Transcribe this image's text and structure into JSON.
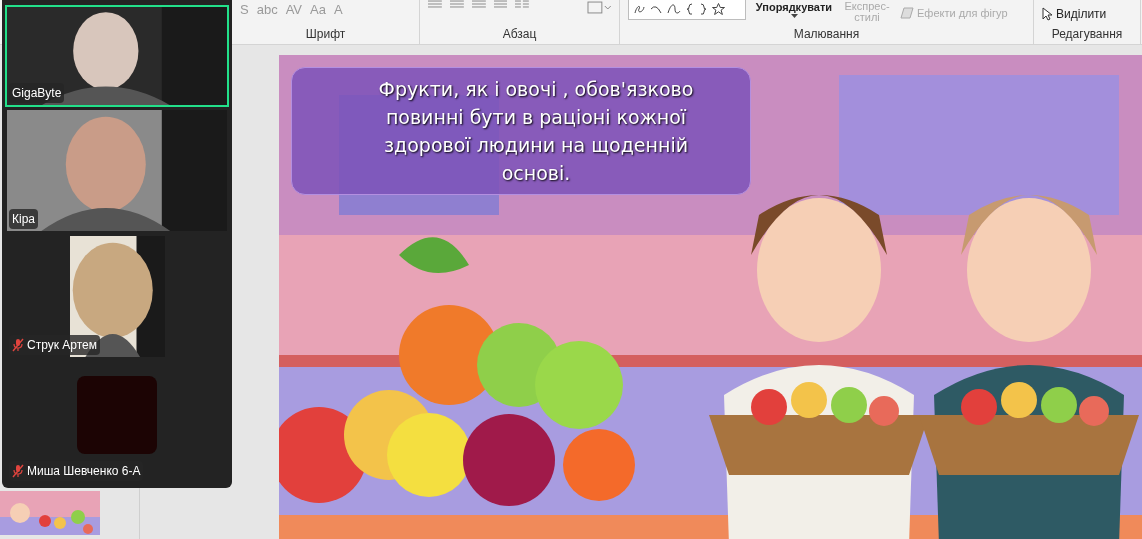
{
  "ribbon": {
    "font_buttons": [
      "S",
      "abc",
      "AV",
      "Aa",
      "A"
    ],
    "arrange_label": "Упорядкувати",
    "quick_styles": [
      "Експрес-",
      "стилі"
    ],
    "shape_effects": "Ефекти для фігур",
    "select": "Виділити",
    "groups": [
      "Шрифт",
      "Абзац",
      "Малювання",
      "Редагування"
    ]
  },
  "slide": {
    "kind": "picture",
    "caption_lines": [
      "Фрукти, як і овочі , обов'язково",
      "повинні бути в раціоні кожної",
      "здорової людини на щоденній",
      "основі."
    ]
  },
  "participants": [
    {
      "name": "GigaByte",
      "video": true,
      "speaking": true,
      "muted": false
    },
    {
      "name": "Кіра",
      "video": true,
      "speaking": false,
      "muted": false
    },
    {
      "name": "Струк Артем",
      "video": true,
      "speaking": false,
      "muted": true
    },
    {
      "name": "Миша Шевченко 6-А",
      "video": false,
      "speaking": false,
      "muted": true
    }
  ]
}
